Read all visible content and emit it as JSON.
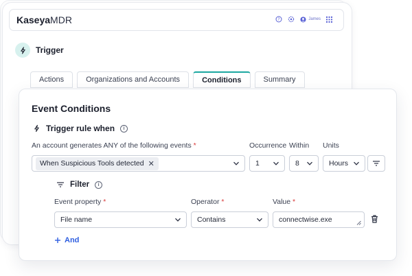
{
  "app": {
    "brand_bold": "Kaseya",
    "brand_rest": "MDR",
    "user_name": "James"
  },
  "icons": {
    "help": "help-icon",
    "settings": "gear-icon",
    "user": "user-icon",
    "apps": "grid-icon",
    "trigger": "lightning-icon"
  },
  "page": {
    "title": "Trigger"
  },
  "tabs": [
    {
      "label": "Actions",
      "active": false
    },
    {
      "label": "Organizations and Accounts",
      "active": false
    },
    {
      "label": "Conditions",
      "active": true
    },
    {
      "label": "Summary",
      "active": false
    }
  ],
  "conditions": {
    "section_title": "Event Conditions",
    "rule_title": "Trigger rule when",
    "events_label": "An account generates ANY of the following events",
    "events_chip": "When Suspicious Tools detected",
    "occurrence_label": "Occurrence",
    "occurrence_value": "1",
    "within_label": "Within",
    "within_value": "8",
    "units_label": "Units",
    "units_value": "Hours",
    "required_mark": "*"
  },
  "filter": {
    "title": "Filter",
    "property_label": "Event property",
    "property_value": "File name",
    "operator_label": "Operator",
    "operator_value": "Contains",
    "value_label": "Value",
    "value_value": "connectwise.exe",
    "and_label": "And"
  },
  "colors": {
    "accent_teal": "#1aa7a0",
    "link_blue": "#2d5ee0",
    "required_red": "#d93a3a"
  }
}
